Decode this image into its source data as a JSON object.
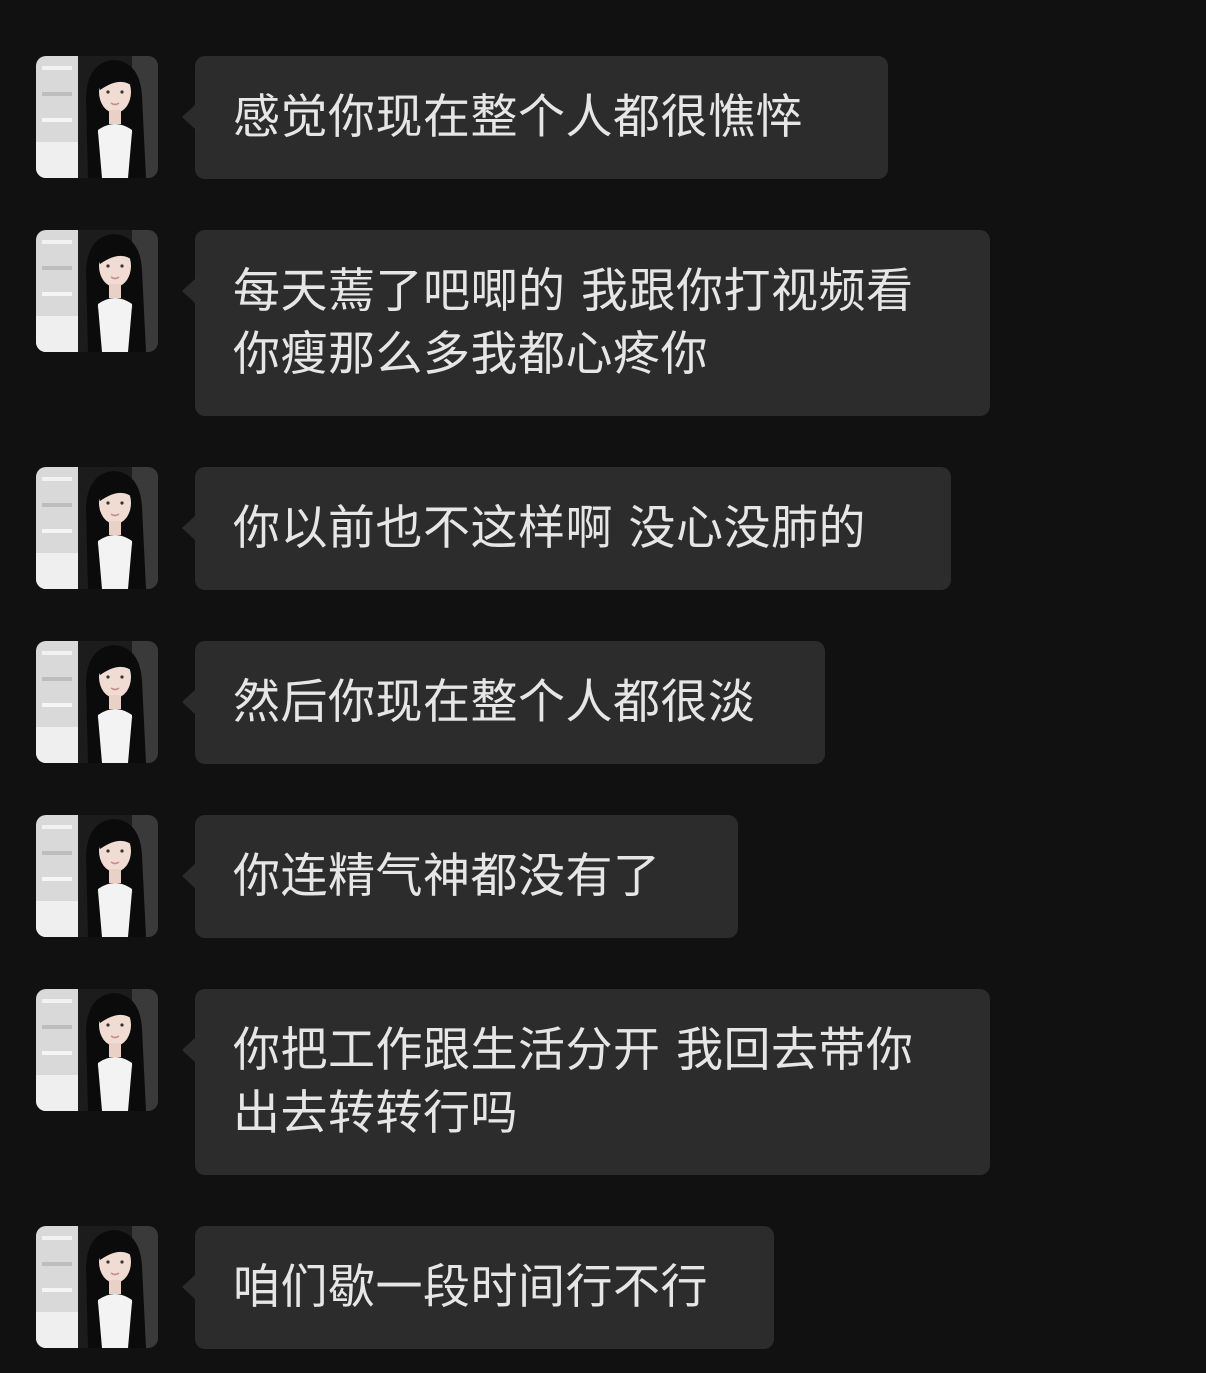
{
  "messages": [
    {
      "text": "感觉你现在整个人都很憔悴"
    },
    {
      "text": "每天蔫了吧唧的 我跟你打视频看你瘦那么多我都心疼你"
    },
    {
      "text": "你以前也不这样啊 没心没肺的"
    },
    {
      "text": "然后你现在整个人都很淡"
    },
    {
      "text": "你连精气神都没有了"
    },
    {
      "text": "你把工作跟生活分开 我回去带你出去转转行吗"
    },
    {
      "text": "咱们歇一段时间行不行"
    }
  ],
  "colors": {
    "background": "#111111",
    "bubble": "#2c2c2c",
    "text": "#e6e6e6"
  }
}
